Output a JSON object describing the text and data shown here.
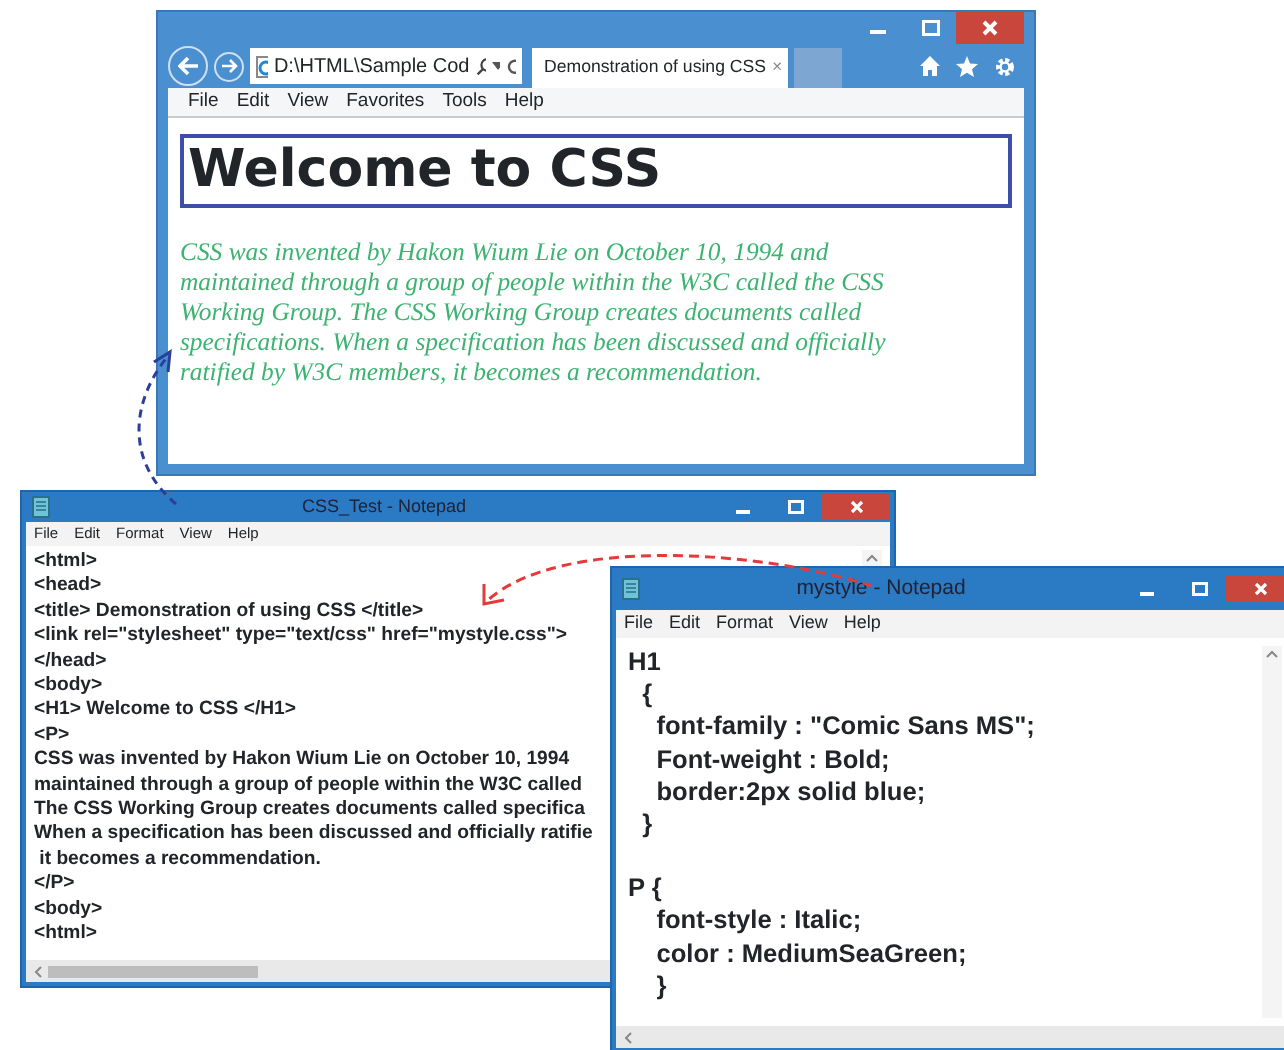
{
  "browser": {
    "address": "D:\\HTML\\Sample Cod",
    "tab": {
      "title": "Demonstration of using CSS",
      "close": "×"
    },
    "menu": [
      "File",
      "Edit",
      "View",
      "Favorites",
      "Tools",
      "Help"
    ],
    "page": {
      "heading": "Welcome to CSS",
      "paragraph_lines": [
        "CSS was invented by Hakon Wium Lie on October 10, 1994 and",
        "maintained through a group of people within the W3C called the CSS",
        "Working Group. The CSS Working Group creates documents called",
        "specifications. When a specification has been discussed and officially",
        "ratified by W3C members, it becomes a recommendation."
      ]
    }
  },
  "notepads": [
    {
      "title": "CSS_Test - Notepad",
      "menu": [
        "File",
        "Edit",
        "Format",
        "View",
        "Help"
      ],
      "blocks": [
        [
          "<html>",
          "<head>",
          "<title> Demonstration of using CSS </title>",
          "<link rel=\"stylesheet\" type=\"text/css\" href=\"mystyle.css\">",
          "</head>",
          "<body>",
          "<H1> Welcome to CSS </H1>",
          "<P>",
          "CSS was invented by Hakon Wium Lie on October 10, 1994",
          "maintained through a group of people within the W3C called",
          "The CSS Working Group creates documents called specifica",
          "When a specification has been discussed and officially ratifie",
          " it becomes a recommendation.",
          "</P>",
          "<body>",
          "<html>"
        ]
      ]
    },
    {
      "title": "mystyle - Notepad",
      "menu": [
        "File",
        "Edit",
        "Format",
        "View",
        "Help"
      ],
      "blocks": [
        [
          "H1",
          "  {",
          "    font-family : \"Comic Sans MS\";",
          "    Font-weight : Bold;",
          "    border:2px solid blue;",
          "  }"
        ],
        [
          "P {",
          "    font-style : Italic;",
          "    color : MediumSeaGreen;",
          "    }"
        ]
      ]
    }
  ]
}
